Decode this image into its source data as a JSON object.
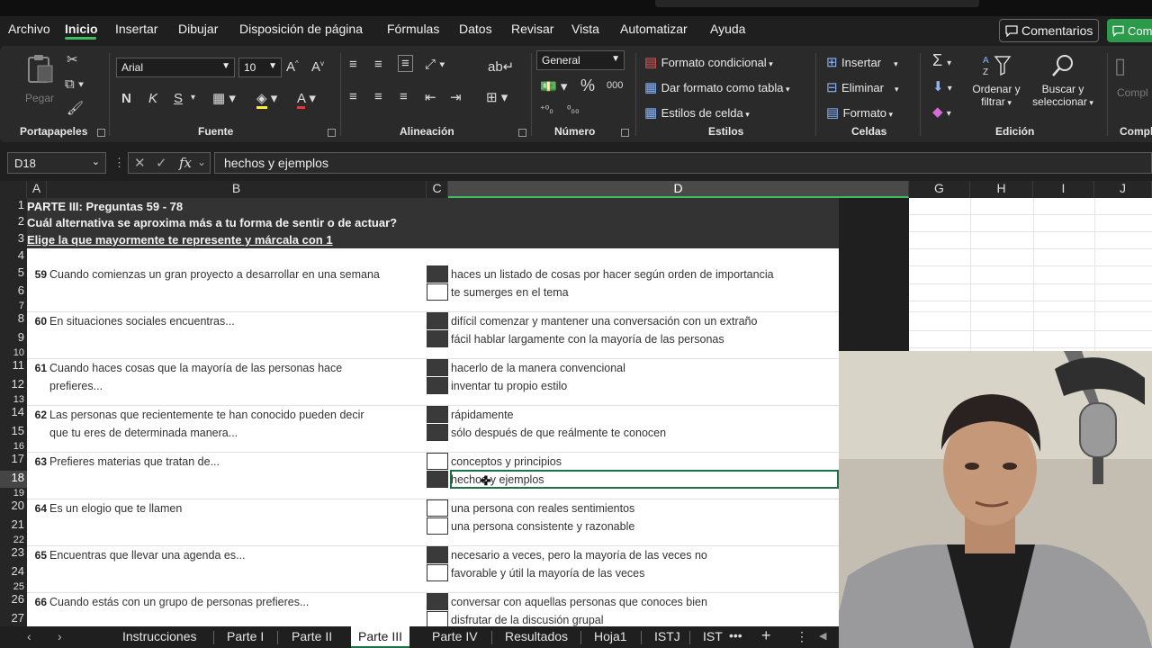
{
  "menu": {
    "items": [
      "Archivo",
      "Inicio",
      "Insertar",
      "Dibujar",
      "Disposición de página",
      "Fórmulas",
      "Datos",
      "Revisar",
      "Vista",
      "Automatizar",
      "Ayuda"
    ],
    "comments_label": "Comentarios",
    "share_label": "Com"
  },
  "ribbon": {
    "clipboard": {
      "paste_label": "Pegar",
      "group": "Portapapeles"
    },
    "font": {
      "name": "Arial",
      "size": "10",
      "bold": "N",
      "italic": "K",
      "underline": "S",
      "group": "Fuente"
    },
    "alignment": {
      "group": "Alineación"
    },
    "number": {
      "format": "General",
      "group": "Número"
    },
    "styles": {
      "conditional": "Formato condicional",
      "table": "Dar formato como tabla",
      "cell": "Estilos de celda",
      "group": "Estilos"
    },
    "cells": {
      "insert": "Insertar",
      "delete": "Eliminar",
      "format": "Formato",
      "group": "Celdas"
    },
    "editing": {
      "sort_1": "Ordenar y",
      "sort_2": "filtrar",
      "find_1": "Buscar y",
      "find_2": "seleccionar",
      "group": "Edición",
      "extra": "Compl",
      "extra_group": "Compl"
    }
  },
  "formula_bar": {
    "name_box": "D18",
    "value": "hechos y ejemplos"
  },
  "columns": [
    "A",
    "B",
    "C",
    "D",
    "G",
    "H",
    "I",
    "J"
  ],
  "rows": [
    "1",
    "2",
    "3",
    "4",
    "5",
    "6",
    "7",
    "8",
    "9",
    "10",
    "11",
    "12",
    "13",
    "14",
    "15",
    "16",
    "17",
    "18",
    "19",
    "20",
    "21",
    "22",
    "23",
    "24",
    "25",
    "26",
    "27"
  ],
  "header": {
    "line1": "PARTE III: Preguntas 59 - 78",
    "line2": "Cuál alternativa se aproxima más a tu forma de sentir o de actuar?",
    "line3": "Elige la que mayormente te represente y márcala con 1"
  },
  "questions": [
    {
      "num": "59",
      "text": [
        "Cuando comienzas un gran proyecto a desarrollar en una semana"
      ],
      "options": [
        {
          "text": "haces un listado de cosas por hacer según orden de importancia",
          "filled": true
        },
        {
          "text": "te sumerges en el tema",
          "filled": false
        }
      ]
    },
    {
      "num": "60",
      "text": [
        "En situaciones sociales encuentras..."
      ],
      "options": [
        {
          "text": "difícil comenzar y mantener una conversación con un extraño",
          "filled": true
        },
        {
          "text": "fácil hablar largamente con la mayoría de las personas",
          "filled": true
        }
      ]
    },
    {
      "num": "61",
      "text": [
        "Cuando haces cosas que la mayoría de las personas hace",
        "prefieres..."
      ],
      "options": [
        {
          "text": "hacerlo de la manera convencional",
          "filled": true
        },
        {
          "text": "inventar tu propio estilo",
          "filled": true
        }
      ]
    },
    {
      "num": "62",
      "text": [
        "Las personas que recientemente te han conocido pueden decir",
        "que tu eres de determinada manera..."
      ],
      "options": [
        {
          "text": "rápidamente",
          "filled": true
        },
        {
          "text": "sólo después de que reálmente te conocen",
          "filled": true
        }
      ]
    },
    {
      "num": "63",
      "text": [
        "Prefieres materias que tratan de..."
      ],
      "options": [
        {
          "text": "conceptos y principios",
          "filled": false
        },
        {
          "text": "hechos y ejemplos",
          "filled": true
        }
      ]
    },
    {
      "num": "64",
      "text": [
        "Es un elogio que te llamen"
      ],
      "options": [
        {
          "text": "una persona con reales sentimientos",
          "filled": false
        },
        {
          "text": "una persona consistente y razonable",
          "filled": false
        }
      ]
    },
    {
      "num": "65",
      "text": [
        "Encuentras que llevar una agenda es..."
      ],
      "options": [
        {
          "text": "necesario a veces, pero la mayoría de las veces no",
          "filled": true
        },
        {
          "text": "favorable y útil la mayoría de las veces",
          "filled": false
        }
      ]
    },
    {
      "num": "66",
      "text": [
        "Cuando estás con un grupo de personas prefieres..."
      ],
      "options": [
        {
          "text": "conversar con aquellas personas que conoces bien",
          "filled": true
        },
        {
          "text": "disfrutar de la discusión grupal",
          "filled": false
        }
      ]
    }
  ],
  "tabs": [
    "Instrucciones",
    "Parte I",
    "Parte II",
    "Parte III",
    "Parte IV",
    "Resultados",
    "Hoja1",
    "ISTJ",
    "IST"
  ],
  "active_tab": "Parte III",
  "colors": {
    "accent_green": "#1e7145",
    "selection_green": "#3fbf5f",
    "header_dark": "#333333"
  }
}
